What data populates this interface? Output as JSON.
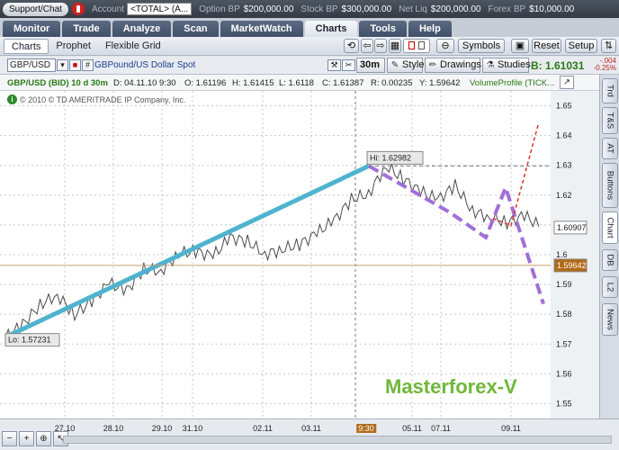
{
  "topbar": {
    "support": "Support/Chat",
    "account_label": "Account",
    "account_value": "<TOTAL> (A...",
    "option_bp_label": "Option BP",
    "option_bp_value": "$200,000.00",
    "stock_bp_label": "Stock BP",
    "stock_bp_value": "$300,000.00",
    "net_liq_label": "Net Liq",
    "net_liq_value": "$200,000.00",
    "forex_bp_label": "Forex BP",
    "forex_bp_value": "$10,000.00"
  },
  "tabs": [
    "Monitor",
    "Trade",
    "Analyze",
    "Scan",
    "MarketWatch",
    "Charts",
    "Tools",
    "Help"
  ],
  "active_tab": "Charts",
  "subtabs": [
    "Charts",
    "Prophet",
    "Flexible Grid"
  ],
  "toolbar": {
    "symbols": "Symbols",
    "reset": "Reset",
    "setup": "Setup"
  },
  "header": {
    "symbol": "GBP/USD",
    "description": "GBPound/US Dollar Spot",
    "timeframe": "30m",
    "style": "Style",
    "drawings": "Drawings",
    "studies": "Studies",
    "bid": "B: 1.61031",
    "change": "-.004",
    "change_pct": "-0.25%"
  },
  "info_row": {
    "title": "GBP/USD (BID) 10 d 30m",
    "date": "D: 04.11.10 9:30",
    "open": "O: 1.61196",
    "high": "H: 1.61415",
    "low": "L: 1.6118",
    "close": "C: 1.61387",
    "range": "R: 0.00235",
    "hl": "Y: 1.59642",
    "study": "VolumeProfile (TICK..."
  },
  "copyright": "© 2010 © TD AMERITRADE IP Company, Inc.",
  "watermark": "Masterforex-V",
  "side_tabs": [
    "Trd",
    "T&S",
    "AT",
    "Buttons",
    "Chart",
    "DB",
    "L2",
    "News"
  ],
  "active_side_tab": "Chart",
  "colors": {
    "up_trend": "#4fb3cf",
    "wave": "#a16fd8",
    "forecast": "#e0312b",
    "watermark": "#6fb73a"
  },
  "chart_data": {
    "type": "line",
    "y_ticks": [
      "1.65",
      "1.64",
      "1.63",
      "1.62",
      "1.61",
      "1.6",
      "1.59",
      "1.58",
      "1.57",
      "1.56",
      "1.55"
    ],
    "ylim": [
      1.545,
      1.655
    ],
    "x_ticks": [
      "27.10",
      "28.10",
      "29.10",
      "31.10",
      "02.11",
      "03.11",
      "05.11",
      "07.11",
      "09.11"
    ],
    "x_highlight": "9:30",
    "hi_label": "Hi: 1.62982",
    "lo_label": "Lo: 1.57231",
    "last_price": "1.60907",
    "crosshair_price": "1.59642",
    "series": [
      {
        "values": [
          1.5723,
          1.5765,
          1.5832,
          1.5865,
          1.5798,
          1.5845,
          1.5905,
          1.5878,
          1.5952,
          1.5945,
          1.6003,
          1.6012,
          1.5995,
          1.6058,
          1.6045,
          1.6002,
          1.6018,
          1.6035,
          1.6072,
          1.6115,
          1.6185,
          1.6205,
          1.6298,
          1.6255,
          1.6212,
          1.6185,
          1.6232,
          1.6148,
          1.6125,
          1.6108,
          1.6132,
          1.6091
        ]
      }
    ]
  }
}
